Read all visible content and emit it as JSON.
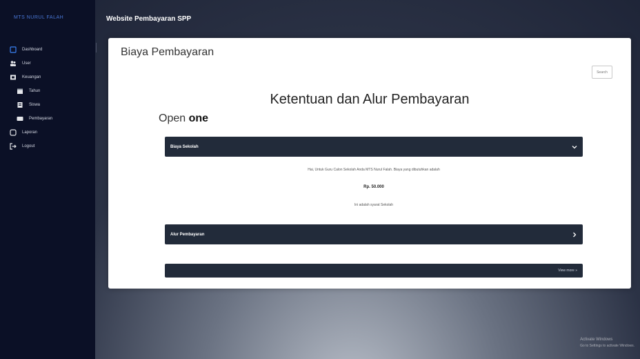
{
  "sidebar": {
    "brand": "MTS NURUL FALAH",
    "items": [
      {
        "label": "Dashboard",
        "icon": "dashboard-icon"
      },
      {
        "label": "User",
        "icon": "users-icon"
      },
      {
        "label": "Keuangan",
        "icon": "finance-icon"
      },
      {
        "label": "Tahun",
        "icon": "calendar-icon"
      },
      {
        "label": "Siswa",
        "icon": "student-icon"
      },
      {
        "label": "Pembayaran",
        "icon": "payment-icon"
      },
      {
        "label": "Laporan",
        "icon": "report-icon"
      },
      {
        "label": "Logout",
        "icon": "logout-icon"
      }
    ]
  },
  "header": {
    "title": "Website Pembayaran SPP"
  },
  "card": {
    "title": "Biaya Pembayaran",
    "search_label": "Search",
    "heading": "Ketentuan dan Alur Pembayaran",
    "open_prefix": "Open",
    "open_bold": "one",
    "accordion": [
      {
        "title": "Biaya Sekolah",
        "body": [
          "Hai, Untuk Guru Calon Sekolah Anda MTS Nurul Falah. Biaya yang dibutuhkan adalah",
          "Rp. 50.000",
          "Ini adalah syarat Sekolah"
        ]
      },
      {
        "title": "Alur Pembayaran"
      },
      {
        "title": "",
        "extra": "View more »"
      }
    ]
  },
  "watermark": {
    "line1": "Activate Windows",
    "line2": "Go to Settings to activate Windows."
  }
}
